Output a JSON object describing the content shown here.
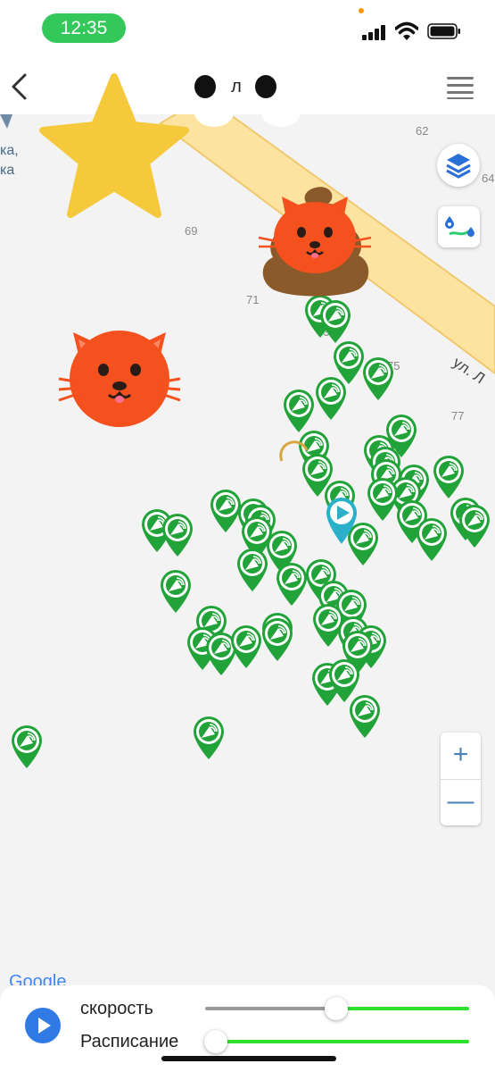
{
  "status_bar": {
    "time": "12:35"
  },
  "header": {
    "title": "л"
  },
  "map": {
    "place_label_line1": "ка,",
    "place_label_line2": "ка",
    "street_label": "ул. Л",
    "numbers": [
      "62",
      "64",
      "69",
      "71",
      "73",
      "75",
      "77"
    ],
    "attribution": "Google"
  },
  "controls": {
    "zoom_in": "+",
    "zoom_out": "—"
  },
  "bottom_panel": {
    "speed_label": "скорость",
    "schedule_label": "Расписание",
    "speed_value": 0.5
  },
  "icons": {
    "back": "chevron-left-icon",
    "menu": "hamburger-icon",
    "layers": "layers-icon",
    "route": "route-icon",
    "play": "play-icon",
    "marker": "bus-stop-marker-icon",
    "vehicle": "vehicle-arrow-icon"
  },
  "colors": {
    "marker_green": "#22a33a",
    "road_fill": "#fde3a0",
    "road_edge": "#f0c96e",
    "accent_blue": "#2f7ae5",
    "slider_green": "#2ee02e"
  }
}
